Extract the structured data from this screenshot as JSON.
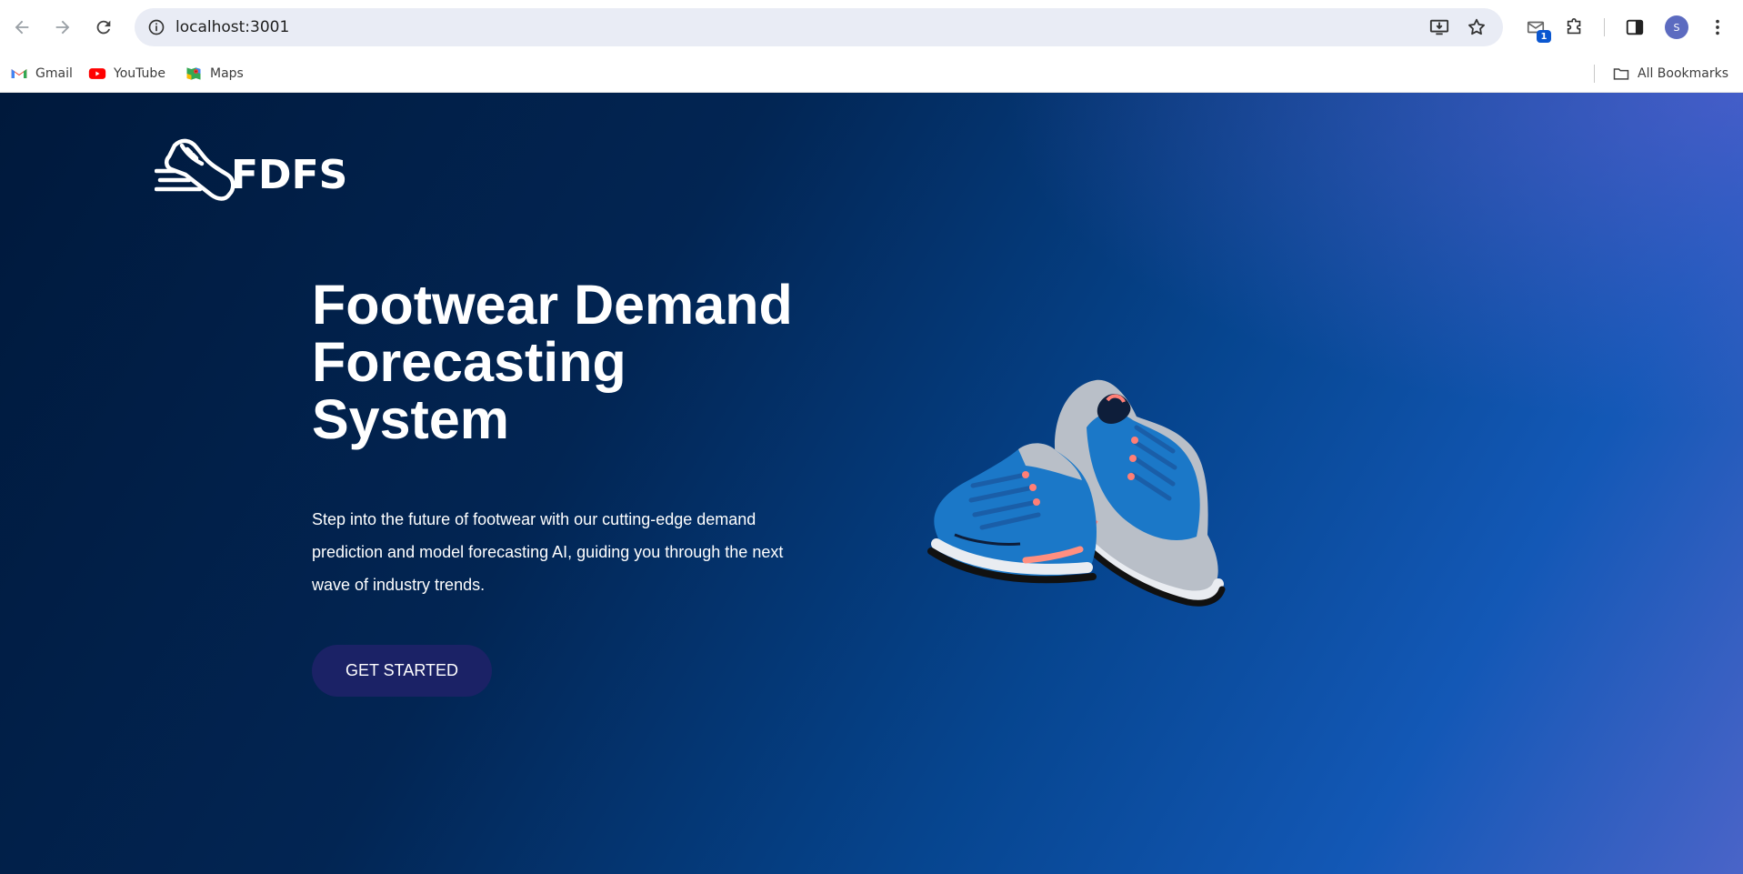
{
  "browser": {
    "url": "localhost:3001",
    "extension_badge": "1",
    "profile_initial": "S",
    "bookmarks": [
      {
        "label": "Gmail",
        "icon": "gmail-icon"
      },
      {
        "label": "YouTube",
        "icon": "youtube-icon"
      },
      {
        "label": "Maps",
        "icon": "maps-icon"
      }
    ],
    "all_bookmarks_label": "All Bookmarks"
  },
  "page": {
    "logo_text": "FDFS",
    "title_lines": [
      "Footwear Demand",
      "Forecasting",
      "System"
    ],
    "description": "Step into the future of footwear with our cutting-edge demand prediction and model forecasting AI, guiding you through the next wave of industry trends.",
    "cta_label": "GET STARTED",
    "colors": {
      "background_dark": "#00193c",
      "background_light": "#1358b6",
      "cta_background": "#1b2266",
      "shoe_blue": "#1b78c8"
    }
  }
}
